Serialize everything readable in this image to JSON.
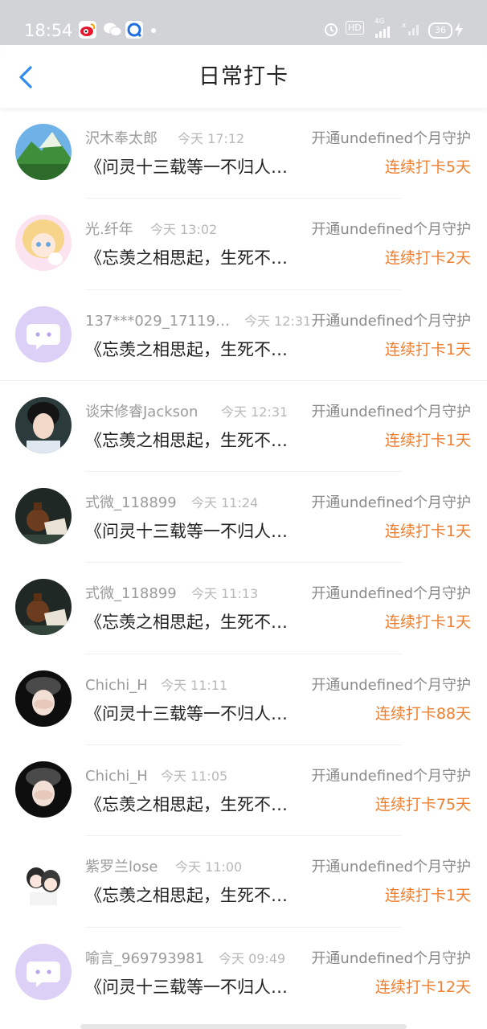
{
  "status_bar": {
    "time": "18:54",
    "network": "HD",
    "signal": "4G",
    "battery": "36"
  },
  "header": {
    "title": "日常打卡",
    "back_icon": "chevron-left-icon"
  },
  "entries": [
    {
      "name": "沢木奉太郎",
      "time": "今天 17:12",
      "guard": "开通undefined个月守护",
      "message": "《问灵十三载等一不归人…",
      "streak": "连续打卡5天",
      "avatar": "landscape"
    },
    {
      "name": "光.纤年",
      "time": "今天 13:02",
      "guard": "开通undefined个月守护",
      "message": "《忘羡之相思起，生死不…",
      "streak": "连续打卡2天",
      "avatar": "anime-girl"
    },
    {
      "name": "137***029_17119…",
      "time": "今天 12:31",
      "guard": "开通undefined个月守护",
      "message": "《忘羡之相思起，生死不…",
      "streak": "连续打卡1天",
      "avatar": "default-chat"
    },
    {
      "name": "谈宋修睿Jackson",
      "time": "今天 12:31",
      "guard": "开通undefined个月守护",
      "message": "《忘羡之相思起，生死不…",
      "streak": "连续打卡1天",
      "avatar": "portrait"
    },
    {
      "name": "式微_118899",
      "time": "今天 11:24",
      "guard": "开通undefined个月守护",
      "message": "《问灵十三载等一不归人…",
      "streak": "连续打卡1天",
      "avatar": "still-life"
    },
    {
      "name": "式微_118899",
      "time": "今天 11:13",
      "guard": "开通undefined个月守护",
      "message": "《忘羡之相思起，生死不…",
      "streak": "连续打卡1天",
      "avatar": "still-life"
    },
    {
      "name": "Chichi_H",
      "time": "今天 11:11",
      "guard": "开通undefined个月守护",
      "message": "《问灵十三载等一不归人…",
      "streak": "连续打卡88天",
      "avatar": "girl-hat"
    },
    {
      "name": "Chichi_H",
      "time": "今天 11:05",
      "guard": "开通undefined个月守护",
      "message": "《忘羡之相思起，生死不…",
      "streak": "连续打卡75天",
      "avatar": "girl-hat"
    },
    {
      "name": "紫罗兰lose",
      "time": "今天 11:00",
      "guard": "开通undefined个月守护",
      "message": "《忘羡之相思起，生死不…",
      "streak": "连续打卡1天",
      "avatar": "chibi-couple"
    },
    {
      "name": "喻言_969793981",
      "time": "今天 09:49",
      "guard": "开通undefined个月守护",
      "message": "《问灵十三载等一不归人…",
      "streak": "连续打卡12天",
      "avatar": "default-chat"
    }
  ],
  "colors": {
    "accent_blue": "#2e8cf0",
    "streak_orange": "#f07e2c",
    "default_avatar": "#ddd0f7"
  }
}
